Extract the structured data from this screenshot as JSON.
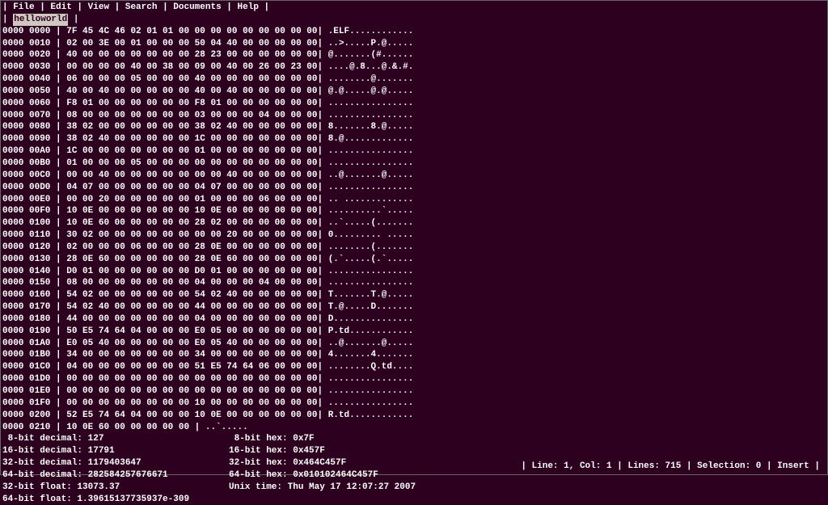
{
  "menu": {
    "items": [
      "File",
      "Edit",
      "View",
      "Search",
      "Documents",
      "Help"
    ]
  },
  "tab": {
    "name": "helloworld"
  },
  "hexlines": [
    {
      "addr": "0000 0000",
      "bytes": "7F 45 4C 46 02 01 01 00 00 00 00 00 00 00 00 00",
      "ascii": ".ELF............"
    },
    {
      "addr": "0000 0010",
      "bytes": "02 00 3E 00 01 00 00 00 50 04 40 00 00 00 00 00",
      "ascii": "..>.....P.@....."
    },
    {
      "addr": "0000 0020",
      "bytes": "40 00 00 00 00 00 00 00 28 23 00 00 00 00 00 00",
      "ascii": "@.......(#......"
    },
    {
      "addr": "0000 0030",
      "bytes": "00 00 00 00 40 00 38 00 09 00 40 00 26 00 23 00",
      "ascii": "....@.8...@.&.#."
    },
    {
      "addr": "0000 0040",
      "bytes": "06 00 00 00 05 00 00 00 40 00 00 00 00 00 00 00",
      "ascii": "........@......."
    },
    {
      "addr": "0000 0050",
      "bytes": "40 00 40 00 00 00 00 00 40 00 40 00 00 00 00 00",
      "ascii": "@.@.....@.@....."
    },
    {
      "addr": "0000 0060",
      "bytes": "F8 01 00 00 00 00 00 00 F8 01 00 00 00 00 00 00",
      "ascii": "................"
    },
    {
      "addr": "0000 0070",
      "bytes": "08 00 00 00 00 00 00 00 03 00 00 00 04 00 00 00",
      "ascii": "................"
    },
    {
      "addr": "0000 0080",
      "bytes": "38 02 00 00 00 00 00 00 38 02 40 00 00 00 00 00",
      "ascii": "8.......8.@....."
    },
    {
      "addr": "0000 0090",
      "bytes": "38 02 40 00 00 00 00 00 1C 00 00 00 00 00 00 00",
      "ascii": "8.@............."
    },
    {
      "addr": "0000 00A0",
      "bytes": "1C 00 00 00 00 00 00 00 01 00 00 00 00 00 00 00",
      "ascii": "................"
    },
    {
      "addr": "0000 00B0",
      "bytes": "01 00 00 00 05 00 00 00 00 00 00 00 00 00 00 00",
      "ascii": "................"
    },
    {
      "addr": "0000 00C0",
      "bytes": "00 00 40 00 00 00 00 00 00 00 40 00 00 00 00 00",
      "ascii": "..@.......@....."
    },
    {
      "addr": "0000 00D0",
      "bytes": "04 07 00 00 00 00 00 00 04 07 00 00 00 00 00 00",
      "ascii": "................"
    },
    {
      "addr": "0000 00E0",
      "bytes": "00 00 20 00 00 00 00 00 01 00 00 00 06 00 00 00",
      "ascii": ".. ............."
    },
    {
      "addr": "0000 00F0",
      "bytes": "10 0E 00 00 00 00 00 00 10 0E 60 00 00 00 00 00",
      "ascii": "..........`....."
    },
    {
      "addr": "0000 0100",
      "bytes": "10 0E 60 00 00 00 00 00 28 02 00 00 00 00 00 00",
      "ascii": "..`.....(......."
    },
    {
      "addr": "0000 0110",
      "bytes": "30 02 00 00 00 00 00 00 00 00 20 00 00 00 00 00",
      "ascii": "0......... ....."
    },
    {
      "addr": "0000 0120",
      "bytes": "02 00 00 00 06 00 00 00 28 0E 00 00 00 00 00 00",
      "ascii": "........(......."
    },
    {
      "addr": "0000 0130",
      "bytes": "28 0E 60 00 00 00 00 00 28 0E 60 00 00 00 00 00",
      "ascii": "(.`.....(.`....."
    },
    {
      "addr": "0000 0140",
      "bytes": "D0 01 00 00 00 00 00 00 D0 01 00 00 00 00 00 00",
      "ascii": "................"
    },
    {
      "addr": "0000 0150",
      "bytes": "08 00 00 00 00 00 00 00 04 00 00 00 04 00 00 00",
      "ascii": "................"
    },
    {
      "addr": "0000 0160",
      "bytes": "54 02 00 00 00 00 00 00 54 02 40 00 00 00 00 00",
      "ascii": "T.......T.@....."
    },
    {
      "addr": "0000 0170",
      "bytes": "54 02 40 00 00 00 00 00 44 00 00 00 00 00 00 00",
      "ascii": "T.@.....D......."
    },
    {
      "addr": "0000 0180",
      "bytes": "44 00 00 00 00 00 00 00 04 00 00 00 00 00 00 00",
      "ascii": "D..............."
    },
    {
      "addr": "0000 0190",
      "bytes": "50 E5 74 64 04 00 00 00 E0 05 00 00 00 00 00 00",
      "ascii": "P.td............"
    },
    {
      "addr": "0000 01A0",
      "bytes": "E0 05 40 00 00 00 00 00 E0 05 40 00 00 00 00 00",
      "ascii": "..@.......@....."
    },
    {
      "addr": "0000 01B0",
      "bytes": "34 00 00 00 00 00 00 00 34 00 00 00 00 00 00 00",
      "ascii": "4.......4......."
    },
    {
      "addr": "0000 01C0",
      "bytes": "04 00 00 00 00 00 00 00 51 E5 74 64 06 00 00 00",
      "ascii": "........Q.td...."
    },
    {
      "addr": "0000 01D0",
      "bytes": "00 00 00 00 00 00 00 00 00 00 00 00 00 00 00 00",
      "ascii": "................"
    },
    {
      "addr": "0000 01E0",
      "bytes": "00 00 00 00 00 00 00 00 00 00 00 00 00 00 00 00",
      "ascii": "................"
    },
    {
      "addr": "0000 01F0",
      "bytes": "00 00 00 00 00 00 00 00 10 00 00 00 00 00 00 00",
      "ascii": "................"
    },
    {
      "addr": "0000 0200",
      "bytes": "52 E5 74 64 04 00 00 00 10 0E 00 00 00 00 00 00",
      "ascii": "R.td............"
    },
    {
      "addr": "0000 0210",
      "bytes": "10 0E 60 00 00 00 00 00 ",
      "ascii": "..`....."
    }
  ],
  "info": {
    "dec8_label": " 8-bit decimal: ",
    "dec8_val": "127",
    "dec16_label": "16-bit decimal: ",
    "dec16_val": "17791",
    "dec32_label": "32-bit decimal: ",
    "dec32_val": "1179403647",
    "dec64_label": "64-bit decimal: ",
    "dec64_val": "282584257676671",
    "flt32_label": "32-bit float: ",
    "flt32_val": "13073.37",
    "flt64_label": "64-bit float: ",
    "flt64_val": "1.39615137735937e-309",
    "hex8_label": " 8-bit hex: ",
    "hex8_val": "0x7F",
    "hex16_label": "16-bit hex: ",
    "hex16_val": "0x457F",
    "hex32_label": "32-bit hex: ",
    "hex32_val": "0x464C457F",
    "hex64_label": "64-bit hex: ",
    "hex64_val": "0x010102464C457F",
    "time_label": "Unix time: ",
    "time_val": "Thu May 17 12:07:27 2007"
  },
  "status": {
    "text": "| Line: 1, Col: 1 | Lines: 715 | Selection: 0 | Insert |"
  }
}
